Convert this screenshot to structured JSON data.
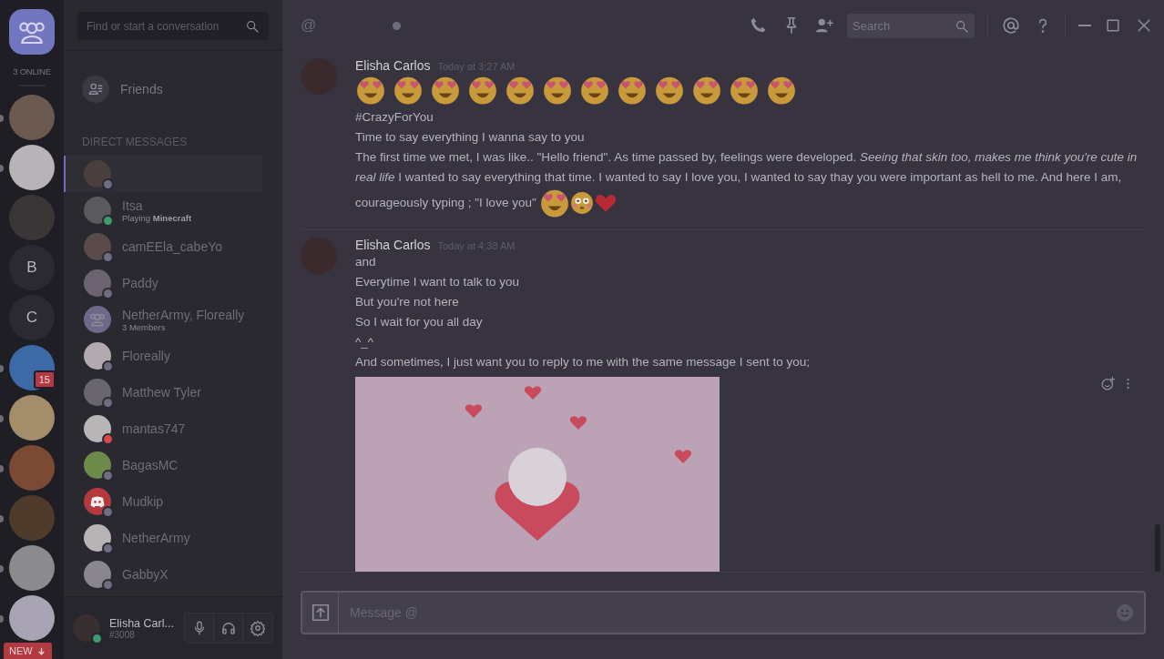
{
  "servers": {
    "online": "3 ONLINE",
    "new_button": "NEW",
    "items": [
      {
        "kind": "avatar",
        "unread": true
      },
      {
        "kind": "avatar",
        "unread": true
      },
      {
        "kind": "avatar",
        "unread": false
      },
      {
        "kind": "letter",
        "label": "B",
        "unread": false
      },
      {
        "kind": "letter",
        "label": "C",
        "unread": false
      },
      {
        "kind": "avatar",
        "unread": true,
        "badge": "15"
      },
      {
        "kind": "avatar",
        "unread": true
      },
      {
        "kind": "avatar",
        "unread": true
      },
      {
        "kind": "avatar",
        "unread": true
      },
      {
        "kind": "avatar",
        "unread": true
      },
      {
        "kind": "avatar",
        "unread": true
      }
    ]
  },
  "dm": {
    "search_placeholder": "Find or start a conversation",
    "friends": "Friends",
    "section": "DIRECT MESSAGES",
    "items": [
      {
        "kind": "user",
        "selected": true,
        "color": "#6f6c80"
      },
      {
        "kind": "user",
        "name": "Itsa",
        "activity": "Playing **Minecraft**",
        "selected": false,
        "color": "#3f9a6e"
      },
      {
        "kind": "user",
        "name": "camEEla_cabeYo",
        "selected": false,
        "color": "#6f6c80"
      },
      {
        "kind": "user",
        "name": "Paddy",
        "selected": false,
        "color": "#6f6c80"
      },
      {
        "kind": "group",
        "name": "NetherArmy, Floreally",
        "subtitle": "3 Members",
        "selected": false
      },
      {
        "kind": "user",
        "name": "Floreally",
        "selected": false,
        "color": "#6f6c80"
      },
      {
        "kind": "user",
        "name": "Matthew Tyler",
        "selected": false,
        "color": "#6f6c80"
      },
      {
        "kind": "user",
        "name": "mantas747",
        "selected": false,
        "color": "#d94a4a"
      },
      {
        "kind": "user",
        "name": "BagasMC",
        "selected": false,
        "color": "#6f6c80"
      },
      {
        "kind": "logo",
        "name": "Mudkip",
        "selected": false,
        "color": "#6f6c80"
      },
      {
        "kind": "user",
        "name": "NetherArmy",
        "selected": false,
        "color": "#6f6c80"
      },
      {
        "kind": "user",
        "name": "GabbyX",
        "selected": false,
        "color": "#6f6c80"
      }
    ]
  },
  "user_panel": {
    "name": "Elisha Carl...",
    "tag": "#3008",
    "color": "#3f9a6e"
  },
  "header": {
    "at": "@",
    "color": "#6f6c80",
    "search_placeholder": "Search"
  },
  "messages": [
    {
      "author": "Elisha Carlos",
      "time": "Today at 3:27 AM",
      "hovered": false,
      "lines": [
        {
          "kind": "emoji",
          "items": [
            {
              "kind": "heart_eyes"
            },
            {
              "kind": "heart_eyes"
            },
            {
              "kind": "heart_eyes"
            },
            {
              "kind": "heart_eyes"
            },
            {
              "kind": "heart_eyes"
            },
            {
              "kind": "heart_eyes"
            },
            {
              "kind": "heart_eyes"
            },
            {
              "kind": "heart_eyes"
            },
            {
              "kind": "heart_eyes"
            },
            {
              "kind": "heart_eyes"
            },
            {
              "kind": "heart_eyes"
            },
            {
              "kind": "heart_eyes"
            }
          ]
        },
        {
          "kind": "text",
          "text": "#CrazyForYou"
        },
        {
          "kind": "text",
          "text": "Time to say everything I wanna say to you"
        },
        {
          "kind": "text",
          "text": "The first time we met, I was like.. \"Hello friend\". As time passed by, feelings were developed. *Seeing that skin too, makes me think you're cute in real life* I wanted to say everything that time. I wanted to say I love you, I wanted to say thay you were important as hell to me. And here I am, courageously typing ; \"I love you\"",
          "emojis": [
            {
              "kind": "heart_eyes"
            },
            {
              "kind": "flushed"
            },
            {
              "kind": "heart"
            }
          ]
        }
      ]
    },
    {
      "author": "Elisha Carlos",
      "time": "Today at 4:38 AM",
      "hovered": true,
      "lines": [
        {
          "kind": "text",
          "text": "and"
        },
        {
          "kind": "text",
          "text": "Everytime I want to talk to you"
        },
        {
          "kind": "text",
          "text": "But you're not here"
        },
        {
          "kind": "text",
          "text": "So I wait for you all day"
        },
        {
          "kind": "text",
          "text": "^_^"
        },
        {
          "kind": "text",
          "text": "And sometimes, I just want you to reply to me with the same message I sent to you;"
        },
        {
          "kind": "image"
        }
      ]
    }
  ],
  "composer": {
    "placeholder": "Message @"
  }
}
